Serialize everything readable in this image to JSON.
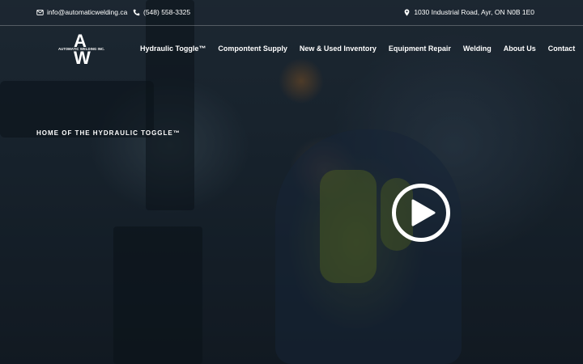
{
  "topbar": {
    "email": "info@automaticwelding.ca",
    "phone": "(548) 558-3325",
    "address": "1030 Industrial Road, Ayr, ON N0B 1E0",
    "icons": {
      "email": "mail-icon",
      "phone": "phone-icon",
      "address": "location-pin-icon"
    }
  },
  "logo": {
    "letter_top": "A",
    "letter_bottom": "W",
    "company": "AUTOMATIC WELDING INC."
  },
  "nav": {
    "items": [
      {
        "label": "Hydraulic Toggle™"
      },
      {
        "label": "Compontent Supply"
      },
      {
        "label": "New & Used Inventory"
      },
      {
        "label": "Equipment Repair"
      },
      {
        "label": "Welding"
      },
      {
        "label": "About Us"
      },
      {
        "label": "Contact"
      }
    ]
  },
  "hero": {
    "eyebrow": "HOME OF THE HYDRAULIC TOGGLE™",
    "play_icon": "play-icon"
  },
  "colors": {
    "text": "#ffffff",
    "overlay": "#1b2530"
  }
}
